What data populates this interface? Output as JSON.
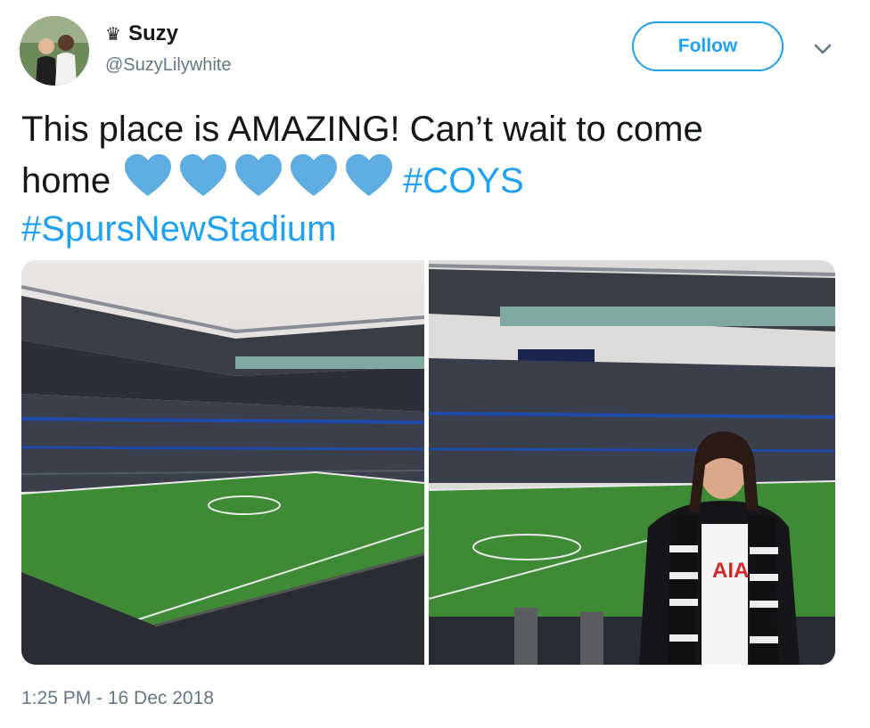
{
  "user": {
    "name": "Suzy",
    "handle": "@SuzyLilywhite",
    "badge_icon": "crown-icon"
  },
  "follow_label": "Follow",
  "menu_icon": "chevron-down-icon",
  "tweet": {
    "line1": "This place is AMAZING! Can’t wait to come",
    "line2_word": "home",
    "heart_count": 5,
    "heart_color": "#5dade2",
    "hashtag_1": "#COYS",
    "hashtag_2": "#SpursNewStadium"
  },
  "colors": {
    "accent": "#1da1f2",
    "secondary_text": "#657786"
  },
  "media": [
    "stadium-interior-photo",
    "fan-in-stadium-photo"
  ],
  "timestamp": "1:25 PM - 16 Dec 2018"
}
